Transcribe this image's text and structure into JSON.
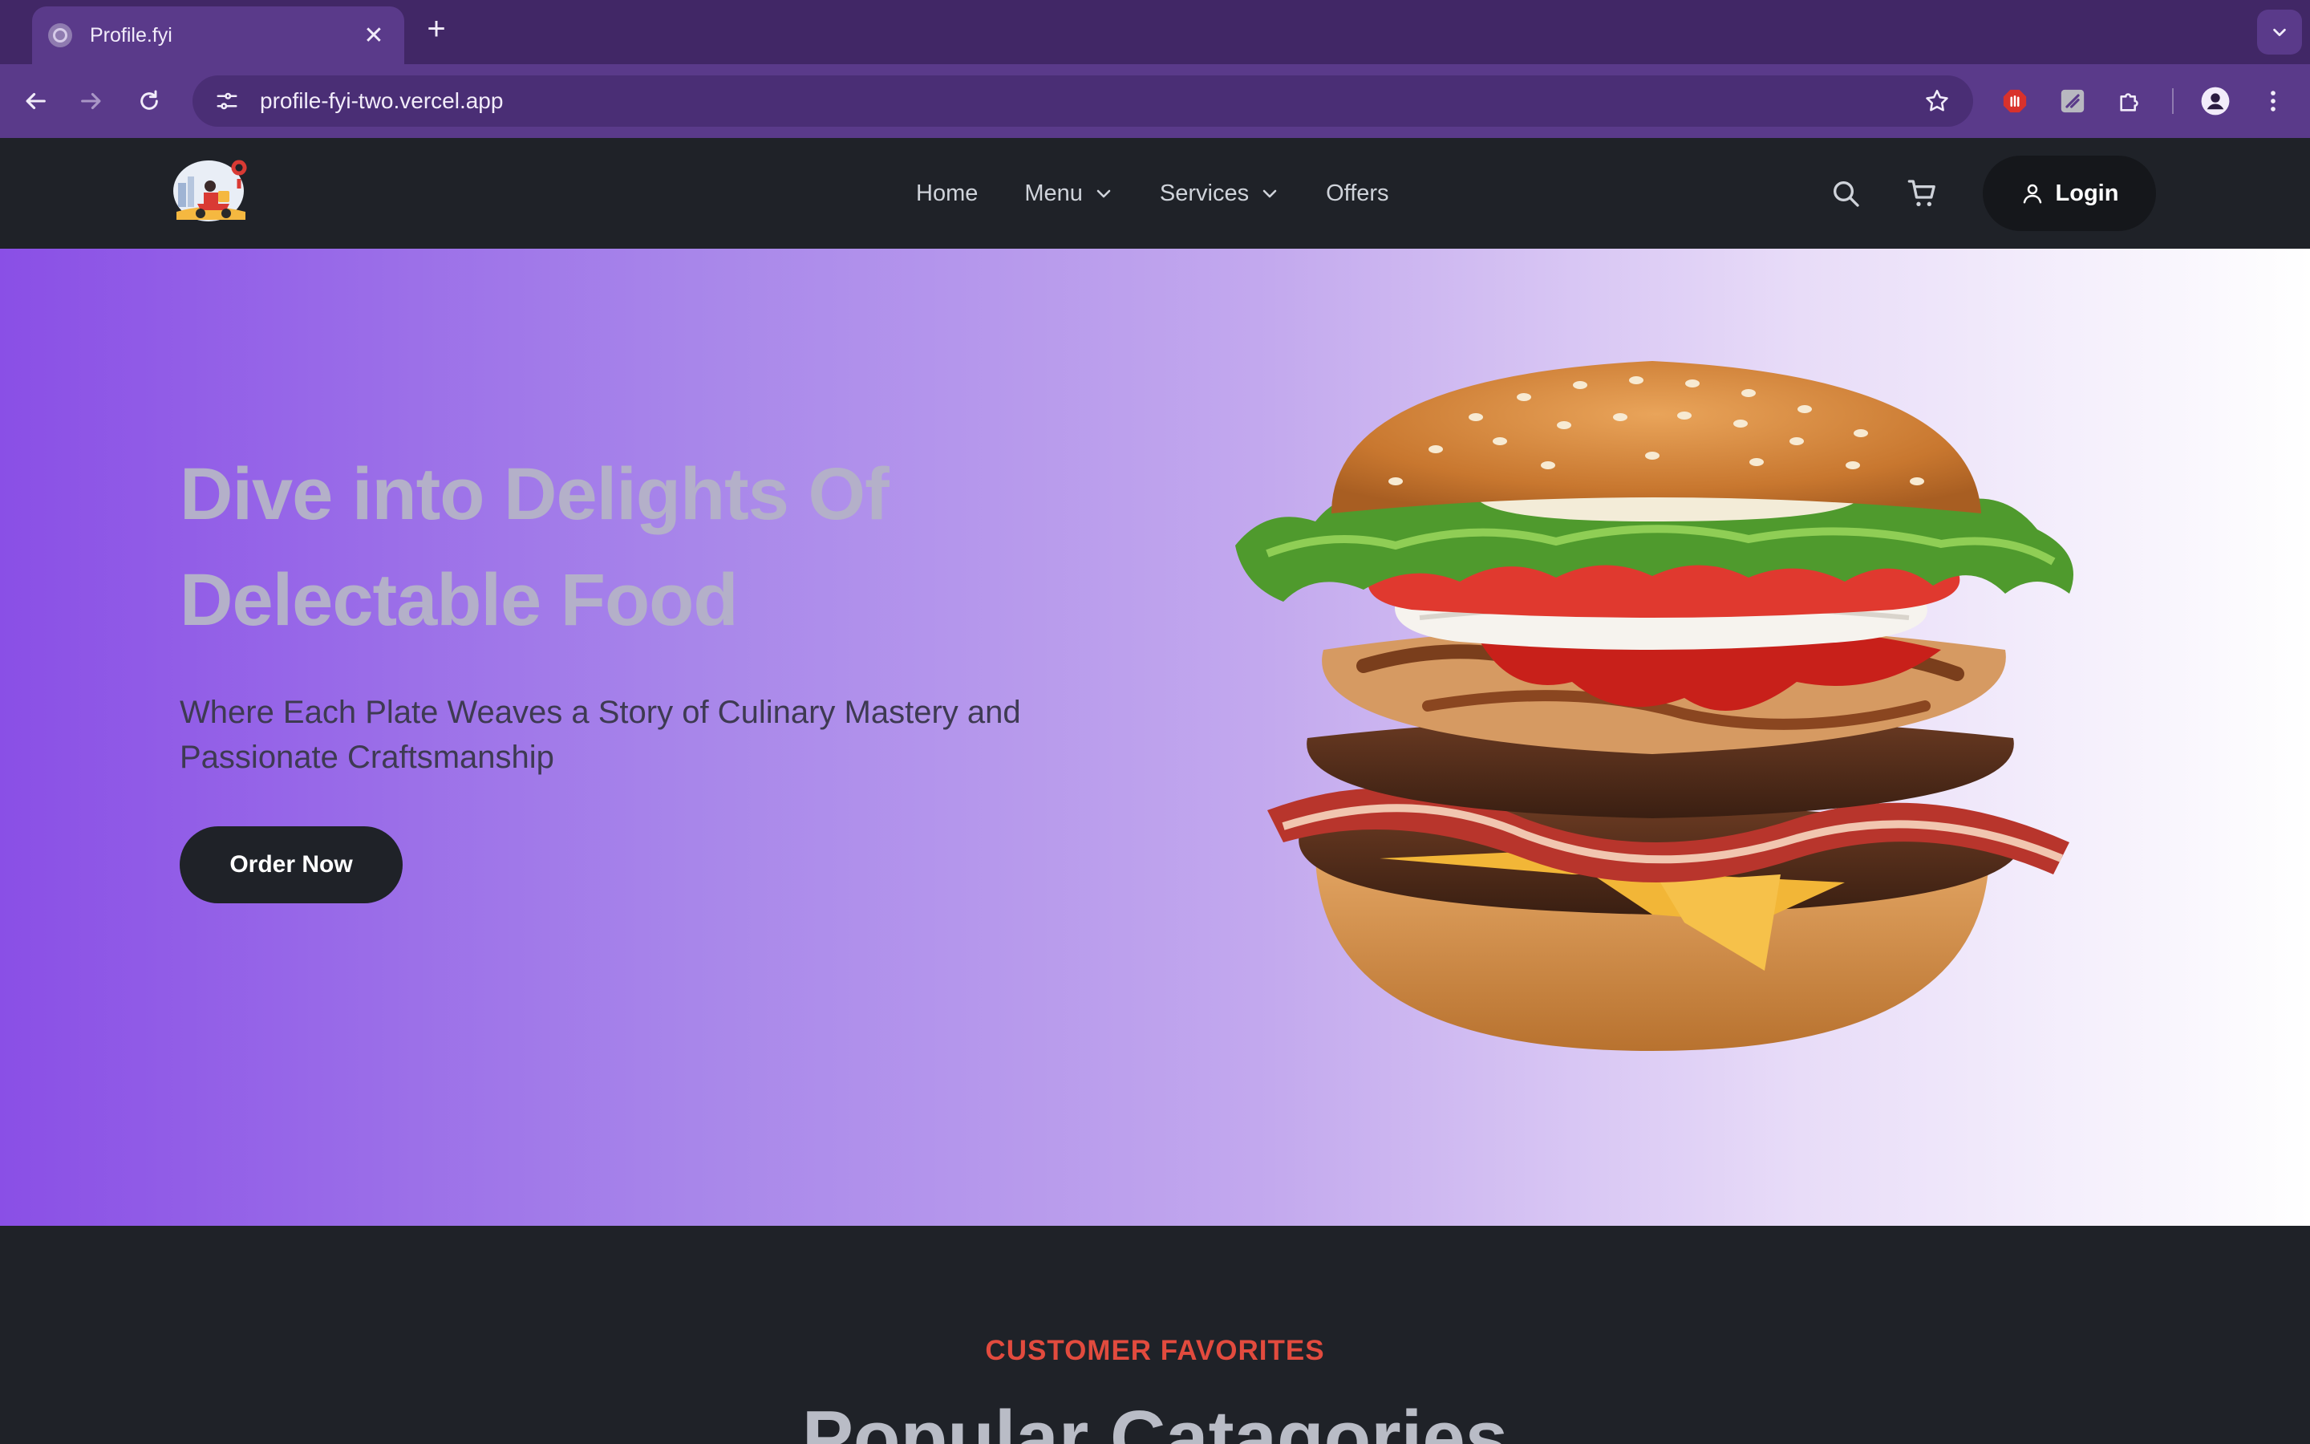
{
  "browser": {
    "tab_title": "Profile.fyi",
    "close_symbol": "✕",
    "new_tab_symbol": "+",
    "url": "profile-fyi-two.vercel.app"
  },
  "nav": {
    "links": [
      {
        "label": "Home"
      },
      {
        "label": "Menu"
      },
      {
        "label": "Services"
      },
      {
        "label": "Offers"
      }
    ],
    "login_label": "Login"
  },
  "hero": {
    "title_line1": "Dive into Delights Of",
    "title_line2": "Delectable Food",
    "subtitle_line1": "Where Each Plate Weaves a Story of Culinary Mastery and",
    "subtitle_line2": "Passionate Craftsmanship",
    "order_button": "Order Now"
  },
  "favorites": {
    "label": "CUSTOMER FAVORITES",
    "title": "Popular Catagories"
  },
  "colors": {
    "tabbar": "#412766",
    "toolbar": "#5a3a8a",
    "navbar": "#1f2228",
    "accent_red": "#e24b3e",
    "hero_start": "#8a4fe6",
    "hero_end": "#ffffff"
  },
  "icons": {
    "back": "arrow-left-icon",
    "forward": "arrow-right-icon",
    "reload": "reload-icon",
    "site_info": "tune-icon",
    "bookmark": "star-icon",
    "search": "search-icon",
    "cart": "cart-icon",
    "user": "user-icon"
  }
}
